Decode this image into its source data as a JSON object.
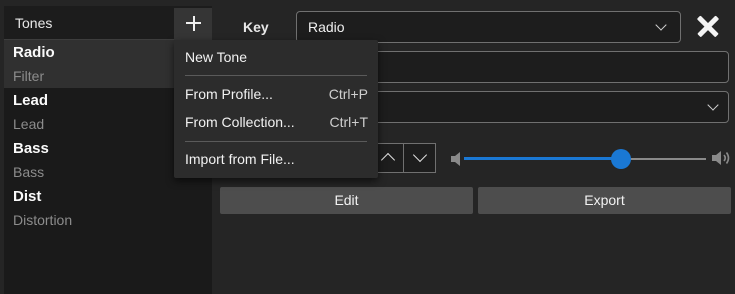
{
  "tones_panel": {
    "title": "Tones",
    "items": [
      {
        "name": "Radio",
        "type": "Filter"
      },
      {
        "name": "Lead",
        "type": "Lead"
      },
      {
        "name": "Bass",
        "type": "Bass"
      },
      {
        "name": "Dist",
        "type": "Distortion"
      }
    ],
    "selected_index": 0
  },
  "editor": {
    "key_label": "Key",
    "key_value": "Radio",
    "volume": 0.65,
    "edit_label": "Edit",
    "export_label": "Export"
  },
  "menu": {
    "new_tone": "New Tone",
    "from_profile": {
      "label": "From Profile...",
      "shortcut": "Ctrl+P"
    },
    "from_collection": {
      "label": "From Collection...",
      "shortcut": "Ctrl+T"
    },
    "import_file": "Import from File..."
  },
  "colors": {
    "accent": "#1a78d4",
    "background": "#252525",
    "panel": "#1a1a1a"
  },
  "icons": [
    "plus-icon",
    "chevron-down-icon",
    "close-icon",
    "chevron-up-icon",
    "volume-low-icon",
    "volume-high-icon"
  ]
}
